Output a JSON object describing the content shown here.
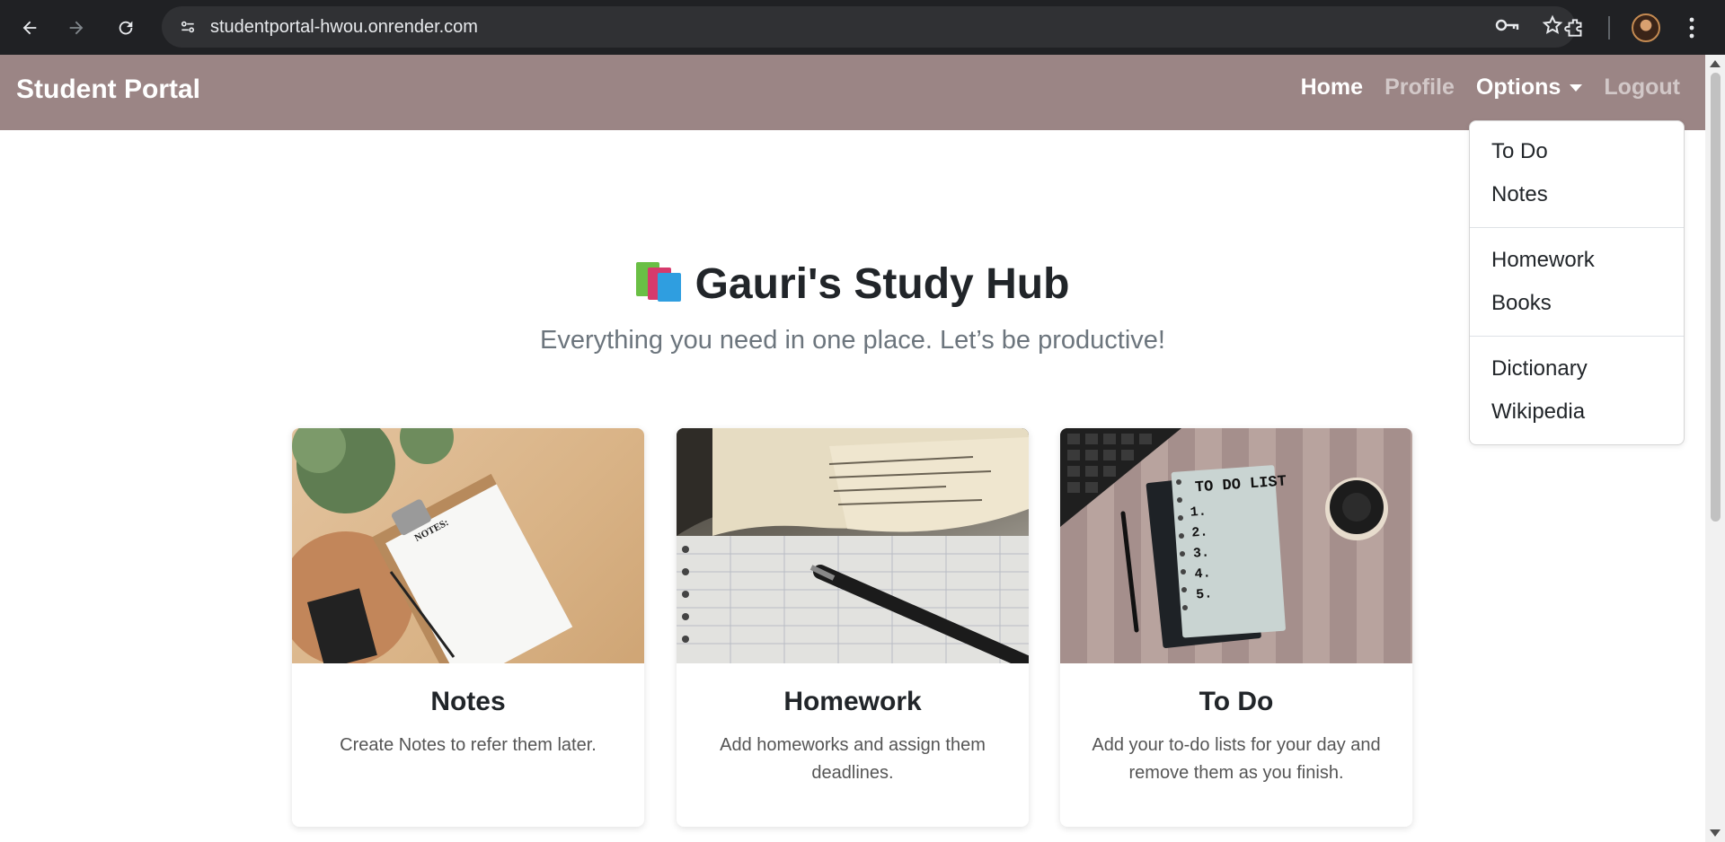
{
  "browser": {
    "url": "studentportal-hwou.onrender.com",
    "icons": [
      "back-arrow-icon",
      "forward-arrow-icon",
      "reload-icon",
      "site-info-icon",
      "key-icon",
      "star-icon",
      "extensions-icon",
      "profile-avatar",
      "more-vert-icon"
    ]
  },
  "navbar": {
    "brand": "Student Portal",
    "links": {
      "home": "Home",
      "profile": "Profile",
      "options": "Options",
      "logout": "Logout"
    },
    "background": "#9b8585"
  },
  "dropdown": {
    "group1": [
      "To Do",
      "Notes"
    ],
    "group2": [
      "Homework",
      "Books"
    ],
    "group3": [
      "Dictionary",
      "Wikipedia"
    ]
  },
  "hero": {
    "title": "Gauri's Study Hub",
    "subtitle": "Everything you need in one place. Let’s be productive!"
  },
  "cards": [
    {
      "title": "Notes",
      "text": "Create Notes to refer them later.",
      "image_note": "NOTES:"
    },
    {
      "title": "Homework",
      "text": "Add homeworks and assign them deadlines."
    },
    {
      "title": "To Do",
      "text": "Add your to-do lists for your day and remove them as you finish.",
      "image_note": "TO DO LIST",
      "list_numbers": [
        "1.",
        "2.",
        "3.",
        "4.",
        "5."
      ]
    }
  ]
}
